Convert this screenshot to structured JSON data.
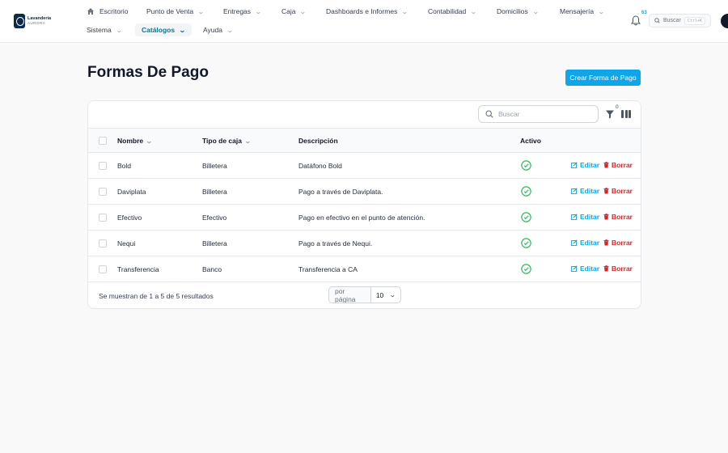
{
  "brand": {
    "line1": "Lavandería",
    "line2": "AURORA"
  },
  "nav": {
    "row1": [
      {
        "label": "Escritorio"
      },
      {
        "label": "Punto de Venta"
      },
      {
        "label": "Entregas"
      },
      {
        "label": "Caja"
      },
      {
        "label": "Dashboards e Informes"
      },
      {
        "label": "Contabilidad"
      },
      {
        "label": "Domicilios"
      },
      {
        "label": "Mensajería"
      }
    ],
    "row2": [
      {
        "label": "Sistema"
      },
      {
        "label": "Catálogos"
      },
      {
        "label": "Ayuda"
      }
    ]
  },
  "notifications": {
    "count": "63"
  },
  "global_search": {
    "label": "Buscar",
    "shortcut": "Ctrl+K"
  },
  "page": {
    "title": "Formas De Pago",
    "create_label": "Crear Forma de Pago"
  },
  "table": {
    "search_placeholder": "Buscar",
    "filter_count": "0",
    "columns": {
      "name": "Nombre",
      "type": "Tipo de caja",
      "desc": "Descripción",
      "active": "Activo"
    },
    "actions": {
      "edit": "Editar",
      "delete": "Borrar"
    },
    "rows": [
      {
        "name": "Bold",
        "type": "Billetera",
        "desc": "Datáfono Bold"
      },
      {
        "name": "Daviplata",
        "type": "Billetera",
        "desc": "Pago a través de Daviplata."
      },
      {
        "name": "Efectivo",
        "type": "Efectivo",
        "desc": "Pago en efectivo en el punto de atención."
      },
      {
        "name": "Nequi",
        "type": "Billetera",
        "desc": "Pago a través de Nequi."
      },
      {
        "name": "Transferencia",
        "type": "Banco",
        "desc": "Transferencia a CA"
      }
    ],
    "footer_text": "Se muestran de 1 a 5 de 5 resultados",
    "per_page_label": "por página",
    "per_page_value": "10"
  },
  "colors": {
    "accent": "#0ea5e9",
    "danger": "#dc2626",
    "success": "#22c55e"
  }
}
